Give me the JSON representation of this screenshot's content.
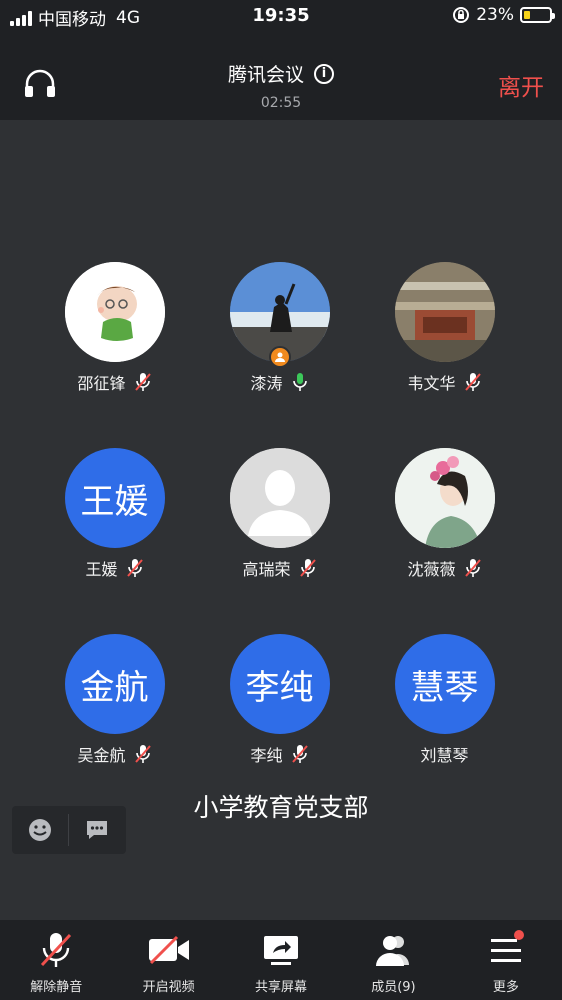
{
  "status_bar": {
    "carrier": "中国移动",
    "network": "4G",
    "time": "19:35",
    "battery": "23%",
    "battery_level": 0.23
  },
  "header": {
    "title": "腾讯会议",
    "timer": "02:55",
    "leave_label": "离开"
  },
  "members": [
    {
      "name": "邵征锋",
      "avatar_type": "photo-cartoon-baby",
      "mic": "muted"
    },
    {
      "name": "漆涛",
      "avatar_type": "photo-seaside-person",
      "mic": "on",
      "sharing": true
    },
    {
      "name": "韦文华",
      "avatar_type": "photo-library",
      "mic": "muted"
    },
    {
      "name": "王媛",
      "avatar_text": "王媛",
      "avatar_type": "text",
      "mic": "muted"
    },
    {
      "name": "高瑞荣",
      "avatar_type": "default-silhouette",
      "mic": "muted"
    },
    {
      "name": "沈薇薇",
      "avatar_type": "photo-woman-flowers",
      "mic": "muted"
    },
    {
      "name": "吴金航",
      "avatar_text": "金航",
      "avatar_type": "text",
      "mic": "muted"
    },
    {
      "name": "李纯",
      "avatar_text": "李纯",
      "avatar_type": "text",
      "mic": "muted"
    },
    {
      "name": "刘慧琴",
      "avatar_text": "慧琴",
      "avatar_type": "text",
      "mic": "none"
    }
  ],
  "group_name": "小学教育党支部",
  "bottom_bar": {
    "unmute": "解除静音",
    "start_video": "开启视频",
    "share_screen": "共享屏幕",
    "members": "成员(9)",
    "more": "更多"
  },
  "colors": {
    "accent_blue": "#2f6de8",
    "leave_red": "#f0504c",
    "mic_green": "#3cc85a",
    "share_orange": "#f08a1e"
  }
}
